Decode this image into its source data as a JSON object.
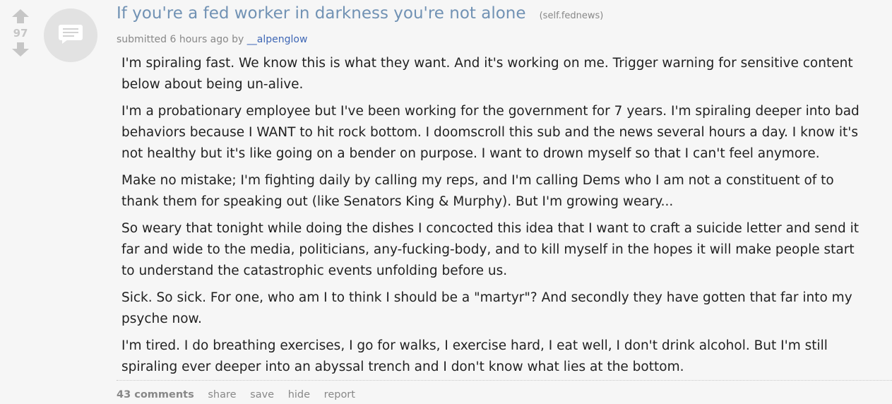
{
  "post": {
    "score": "97",
    "title": "If you're a fed worker in darkness you're not alone",
    "domain": "(self.fednews)",
    "submitted_prefix": "submitted",
    "time": "6 hours ago",
    "by_label": "by",
    "author": "__alpenglow",
    "body": [
      "I'm spiraling fast. We know this is what they want. And it's working on me. Trigger warning for sensitive content below about being un-alive.",
      "I'm a probationary employee but I've been working for the government for 7 years. I'm spiraling deeper into bad behaviors because I WANT to hit rock bottom. I doomscroll this sub and the news several hours a day. I know it's not healthy but it's like going on a bender on purpose. I want to drown myself so that I can't feel anymore.",
      "Make no mistake; I'm fighting daily by calling my reps, and I'm calling Dems who I am not a constituent of to thank them for speaking out (like Senators King & Murphy). But I'm growing weary...",
      "So weary that tonight while doing the dishes I concocted this idea that I want to craft a suicide letter and send it far and wide to the media, politicians, any-fucking-body, and to kill myself in the hopes it will make people start to understand the catastrophic events unfolding before us.",
      "Sick. So sick. For one, who am I to think I should be a \"martyr\"? And secondly they have gotten that far into my psyche now.",
      "I'm tired. I do breathing exercises, I go for walks, I exercise hard, I eat well, I don't drink alcohol. But I'm still spiraling ever deeper into an abyssal trench and I don't know what lies at the bottom."
    ],
    "actions": {
      "comments": "43 comments",
      "share": "share",
      "save": "save",
      "hide": "hide",
      "report": "report"
    }
  },
  "icons": {
    "upvote": "upvote-arrow-icon",
    "downvote": "downvote-arrow-icon",
    "self_post": "self-post-text-icon"
  },
  "colors": {
    "title": "#7192b4",
    "author": "#3f67b5",
    "muted": "#888888",
    "arrow": "#c6c6c6",
    "background": "#f6f6f6"
  }
}
